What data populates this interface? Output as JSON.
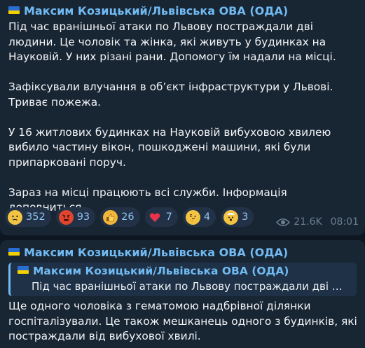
{
  "messages": [
    {
      "author": "Максим Козицький/Львівська ОВА (ОДА)",
      "paragraphs": [
        "Під час вранішньої атаки по Львову постраждали дві людини. Це чоловік та жінка, які живуть у будинках на Науковій. У них різані рани. Допомогу їм надали на місці.",
        "Зафіксували влучання в об’єкт інфраструктури у Львові. Триває пожежа.",
        "У 16 житлових будинках на Науковій вибуховою хвилею вибило частину вікон, пошкоджені машини, які були припарковані поруч.",
        "Зараз на місці працюють всі служби. Інформація доповниться."
      ],
      "reactions": [
        {
          "icon": "crying-face-emoji",
          "count": "352"
        },
        {
          "icon": "angry-face-emoji",
          "count": "93"
        },
        {
          "icon": "thumbs-up-emoji",
          "count": "26"
        },
        {
          "icon": "red-heart-emoji",
          "count": "7"
        },
        {
          "icon": "thinking-face-emoji",
          "count": "4"
        },
        {
          "icon": "exploding-head-emoji",
          "count": "3"
        }
      ],
      "views": "21.6K",
      "time": "08:01"
    },
    {
      "author": "Максим Козицький/Львівська ОВА (ОДА)",
      "reply": {
        "author": "Максим Козицький/Львівська ОВА (ОДА)",
        "text": "Під час вранішньої атаки по Львову постраждали дві людин..."
      },
      "paragraphs": [
        "Ще одного чоловіка з гематомою надбрівної ділянки госпіталізували. Це також мешканець одного з будинків, які постраждали від вибухової хвилі."
      ]
    }
  ],
  "colors": {
    "background": "#0e1621",
    "bubble": "#182533",
    "author": "#71baf2",
    "meta": "#6d7f8f"
  }
}
